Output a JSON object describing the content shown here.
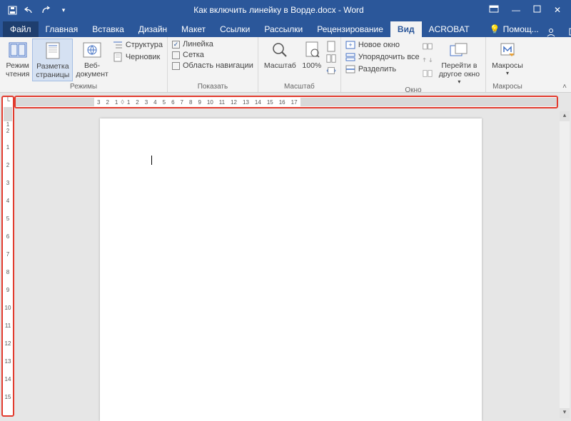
{
  "titlebar": {
    "doc_title": "Как включить линейку в Ворде.docx - Word"
  },
  "tabs": {
    "file": "Файл",
    "items": [
      "Главная",
      "Вставка",
      "Дизайн",
      "Макет",
      "Ссылки",
      "Рассылки",
      "Рецензирование",
      "Вид",
      "ACROBAT"
    ],
    "active": "Вид",
    "help": "Помощ..."
  },
  "ribbon": {
    "views": {
      "read": "Режим\nчтения",
      "layout": "Разметка\nстраницы",
      "web": "Веб-\nдокумент",
      "outline": "Структура",
      "draft": "Черновик",
      "label": "Режимы"
    },
    "show": {
      "ruler": "Линейка",
      "grid": "Сетка",
      "nav": "Область навигации",
      "label": "Показать"
    },
    "zoom": {
      "zoom": "Масштаб",
      "hundred": "100%",
      "label": "Масштаб"
    },
    "window": {
      "new": "Новое окно",
      "arrange": "Упорядочить все",
      "split": "Разделить",
      "switch": "Перейти в\nдругое окно",
      "label": "Окно"
    },
    "macros": {
      "btn": "Макросы",
      "label": "Макросы"
    }
  },
  "hruler": {
    "left": [
      "3",
      "2",
      "1"
    ],
    "right": [
      "1",
      "2",
      "3",
      "4",
      "5",
      "6",
      "7",
      "8",
      "9",
      "10",
      "11",
      "12",
      "13",
      "14",
      "15",
      "16",
      "17"
    ]
  },
  "vruler": {
    "top": [
      "1",
      "2"
    ],
    "nums": [
      "1",
      "2",
      "3",
      "4",
      "5",
      "6",
      "7",
      "8",
      "9",
      "10",
      "11",
      "12",
      "13",
      "14",
      "15"
    ]
  }
}
